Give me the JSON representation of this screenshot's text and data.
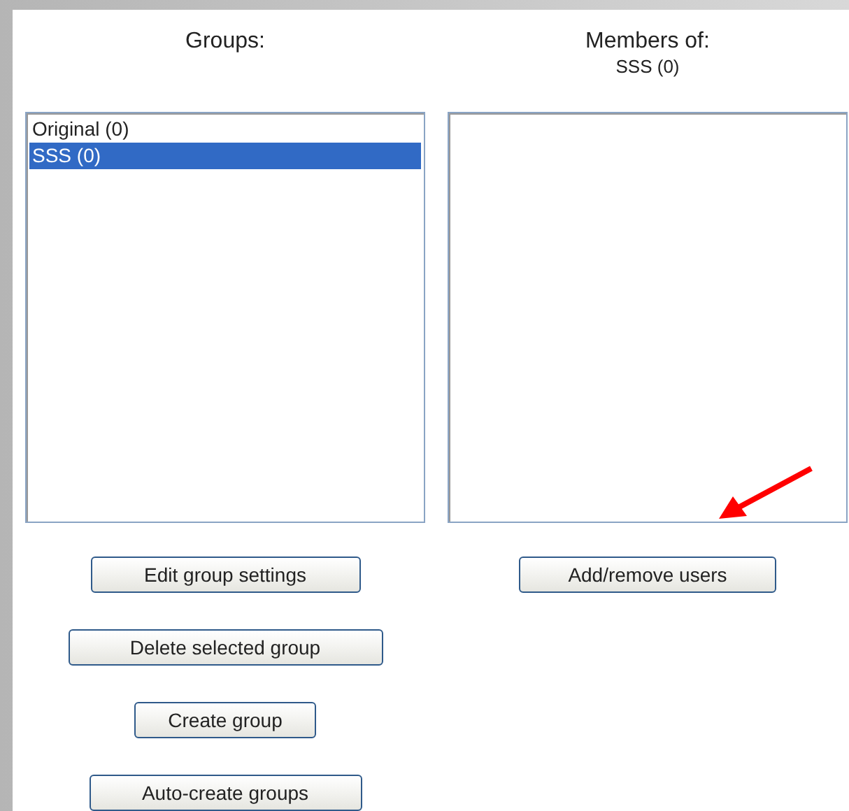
{
  "groups": {
    "heading": "Groups:",
    "items": [
      {
        "label": "Original (0)",
        "selected": false
      },
      {
        "label": "SSS (0)",
        "selected": true
      }
    ],
    "buttons": [
      "Edit group settings",
      "Delete selected group",
      "Create group",
      "Auto-create groups"
    ]
  },
  "members": {
    "heading": "Members of:",
    "subtitle": "SSS (0)",
    "buttons": [
      "Add/remove users"
    ]
  }
}
